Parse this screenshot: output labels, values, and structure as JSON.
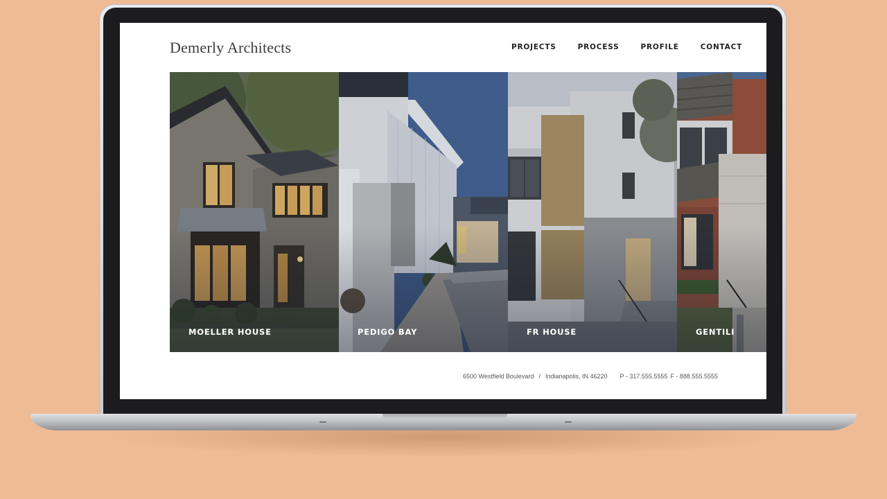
{
  "site": {
    "logo": "Demerly Architects",
    "nav": [
      "PROJECTS",
      "PROCESS",
      "PROFILE",
      "CONTACT"
    ]
  },
  "projects": [
    {
      "name": "MOELLER HOUSE"
    },
    {
      "name": "PEDIGO BAY"
    },
    {
      "name": "FR HOUSE"
    },
    {
      "name": "GENTILI"
    }
  ],
  "footer": {
    "address": "6500 Westfield Boulevard",
    "separator": "/",
    "city": "Indianapolis, IN 46220",
    "phone": "P - 317.555.5555",
    "fax": "F - 888.555.5555"
  },
  "colors": {
    "background": "#efbb95",
    "text": "#222222",
    "caption": "#ffffff"
  }
}
